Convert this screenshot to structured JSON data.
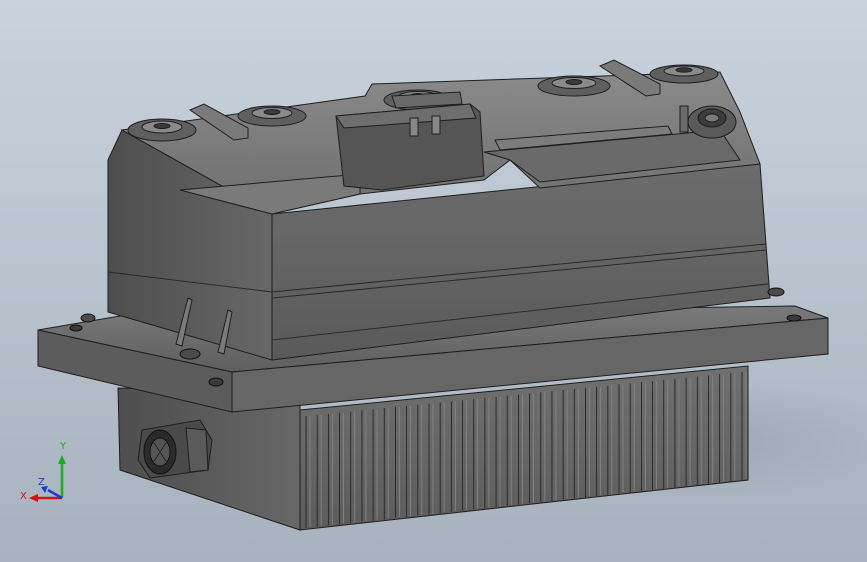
{
  "viewport": {
    "background_top": "#c9d3de",
    "background_bottom": "#a7b2be"
  },
  "model": {
    "body_color": "#6b6b6b",
    "edge_color": "#1e1e1e",
    "highlight_color": "#9a9a9a"
  },
  "triad": {
    "x_label": "X",
    "y_label": "Y",
    "z_label": "Z",
    "x_color": "#d01414",
    "y_color": "#1faa1f",
    "z_color": "#1f3ad0"
  }
}
